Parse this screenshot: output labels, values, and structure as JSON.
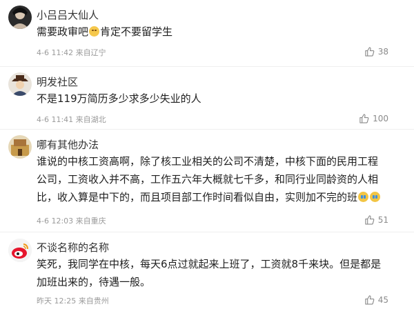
{
  "comments": [
    {
      "name": "小吕吕大仙人",
      "text_parts": [
        "需要政审吧",
        "肯定不要留学生"
      ],
      "emoji": "shy-smile-emoji",
      "time": "4-6 11:42",
      "location": "来自辽宁",
      "likes": "38"
    },
    {
      "name": "明发社区",
      "text": "不是119万简历多少求多少失业的人",
      "time": "4-6 11:41",
      "location": "来自湖北",
      "likes": "100"
    },
    {
      "name": "哪有其他办法",
      "text_lines": [
        "谁说的中核工资高啊，除了核工业相关的公司不清楚，中核下面的民用工程",
        "公司，工资收入并不高，工作五六年大概就七千多，和同行业同龄资的人相",
        "比，收入算是中下的，而且项目部工作时间看似自由，实则加不完的班"
      ],
      "emoji": "crying-emoji",
      "time": "4-6 12:03",
      "location": "来自重庆",
      "likes": "51"
    },
    {
      "name": "不谈名称的名称",
      "text_lines": [
        "笑死，我同学在中核，每天6点过就起来上班了，工资就8千来块。但是都是",
        "加班出来的，待遇一般。"
      ],
      "time": "昨天 12:25",
      "location": "来自贵州",
      "likes": "45"
    }
  ],
  "icons": {
    "like": "thumbs-up-icon"
  },
  "colors": {
    "meta": "#9a9a9a",
    "divider": "#efefef",
    "text": "#1e1e1e"
  }
}
